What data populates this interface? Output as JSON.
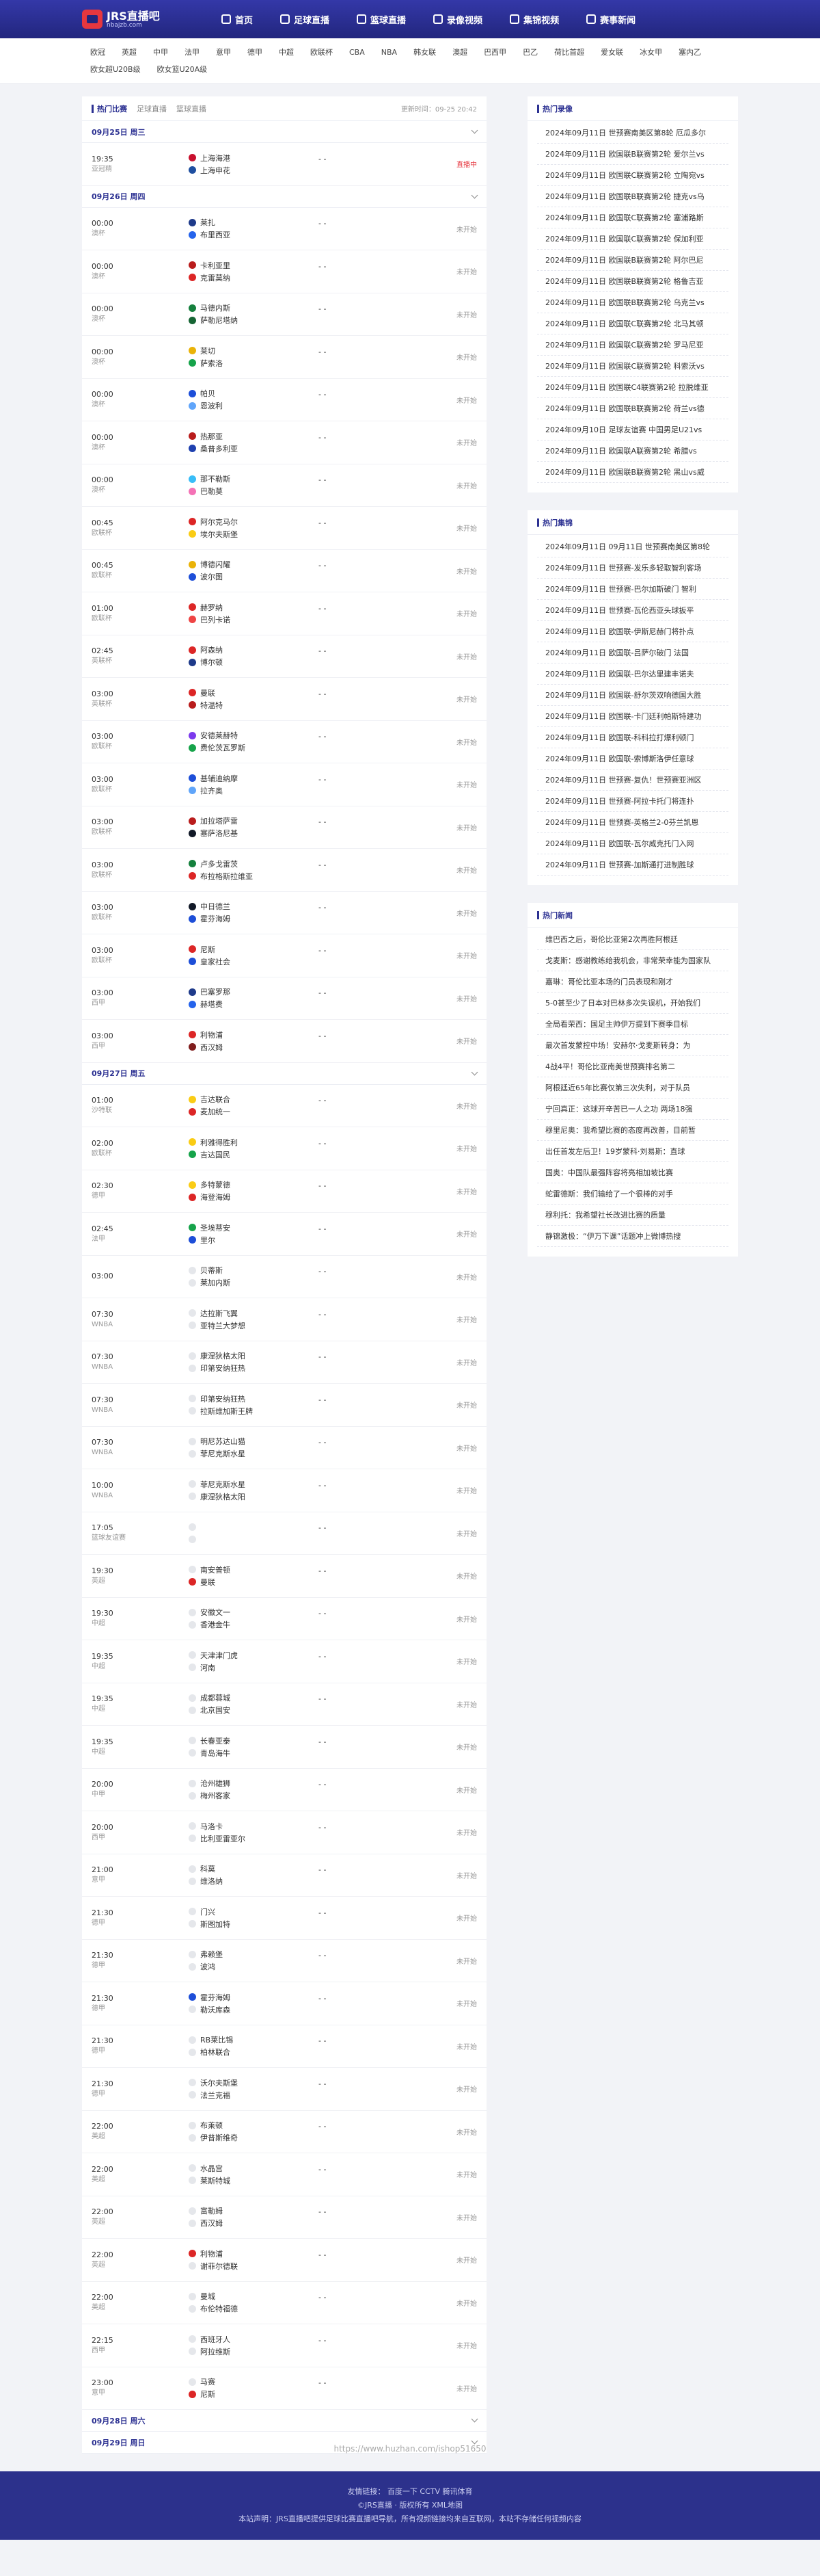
{
  "header": {
    "logo_title": "JRS直播吧",
    "logo_sub": "nbajzb.com",
    "nav": [
      "首页",
      "足球直播",
      "篮球直播",
      "录像视频",
      "集锦视频",
      "赛事新闻"
    ]
  },
  "leagues": [
    "欧冠",
    "英超",
    "中甲",
    "法甲",
    "意甲",
    "德甲",
    "中超",
    "欧联杯",
    "CBA",
    "NBA",
    "韩女联",
    "澳超",
    "巴西甲",
    "巴乙",
    "荷比首超",
    "爱女联",
    "冰女甲",
    "塞内乙",
    "欧女超U20B级",
    "欧女篮U20A级"
  ],
  "schedule": {
    "title": "热门比赛",
    "tabs": [
      "足球直播",
      "篮球直播"
    ],
    "update": "更新时间：09-25 20:42",
    "days": [
      {
        "date": "09月25日 周三",
        "matches": [
          {
            "time": "19:35",
            "league": "亚冠精",
            "home": "上海海港",
            "away": "上海申花",
            "status": "直播中",
            "live": true,
            "hc": "#c8102e",
            "ac": "#1f4fa0"
          }
        ]
      },
      {
        "date": "09月26日 周四",
        "matches": [
          {
            "time": "00:00",
            "league": "澳杯",
            "home": "莱扎",
            "away": "布里西亚",
            "status": "未开始",
            "hc": "#1e3a8a",
            "ac": "#2563eb"
          },
          {
            "time": "00:00",
            "league": "澳杯",
            "home": "卡利亚里",
            "away": "克雷莫纳",
            "status": "未开始",
            "hc": "#b91c1c",
            "ac": "#dc2626"
          },
          {
            "time": "00:00",
            "league": "澳杯",
            "home": "马德内斯",
            "away": "萨勒尼塔纳",
            "status": "未开始",
            "hc": "#15803d",
            "ac": "#166534"
          },
          {
            "time": "00:00",
            "league": "澳杯",
            "home": "莱切",
            "away": "萨索洛",
            "status": "未开始",
            "hc": "#eab308",
            "ac": "#16a34a"
          },
          {
            "time": "00:00",
            "league": "澳杯",
            "home": "帕贝",
            "away": "恩波利",
            "status": "未开始",
            "hc": "#1d4ed8",
            "ac": "#60a5fa"
          },
          {
            "time": "00:00",
            "league": "澳杯",
            "home": "热那亚",
            "away": "桑普多利亚",
            "status": "未开始",
            "hc": "#b91c1c",
            "ac": "#1e40af"
          },
          {
            "time": "00:00",
            "league": "澳杯",
            "home": "那不勒斯",
            "away": "巴勒莫",
            "status": "未开始",
            "hc": "#38bdf8",
            "ac": "#f472b6"
          },
          {
            "time": "00:45",
            "league": "欧联杯",
            "home": "阿尔克马尔",
            "away": "埃尔夫斯堡",
            "status": "未开始",
            "hc": "#dc2626",
            "ac": "#facc15"
          },
          {
            "time": "00:45",
            "league": "欧联杯",
            "home": "博德闪耀",
            "away": "波尔图",
            "status": "未开始",
            "hc": "#eab308",
            "ac": "#1d4ed8"
          },
          {
            "time": "01:00",
            "league": "欧联杯",
            "home": "赫罗纳",
            "away": "巴列卡诺",
            "status": "未开始",
            "hc": "#dc2626",
            "ac": "#ef4444"
          },
          {
            "time": "02:45",
            "league": "英联杯",
            "home": "阿森纳",
            "away": "博尔顿",
            "status": "未开始",
            "hc": "#dc2626",
            "ac": "#1e3a8a"
          },
          {
            "time": "03:00",
            "league": "英联杯",
            "home": "曼联",
            "away": "特温特",
            "status": "未开始",
            "hc": "#dc2626",
            "ac": "#b91c1c"
          },
          {
            "time": "03:00",
            "league": "欧联杯",
            "home": "安德莱赫特",
            "away": "费伦茨瓦罗斯",
            "status": "未开始",
            "hc": "#7c3aed",
            "ac": "#16a34a"
          },
          {
            "time": "03:00",
            "league": "欧联杯",
            "home": "基辅迪纳摩",
            "away": "拉齐奥",
            "status": "未开始",
            "hc": "#1d4ed8",
            "ac": "#60a5fa"
          },
          {
            "time": "03:00",
            "league": "欧联杯",
            "home": "加拉塔萨雷",
            "away": "塞萨洛尼基",
            "status": "未开始",
            "hc": "#b91c1c",
            "ac": "#111827"
          },
          {
            "time": "03:00",
            "league": "欧联杯",
            "home": "卢多戈雷茨",
            "away": "布拉格斯拉维亚",
            "status": "未开始",
            "hc": "#15803d",
            "ac": "#dc2626"
          },
          {
            "time": "03:00",
            "league": "欧联杯",
            "home": "中日德兰",
            "away": "霍芬海姆",
            "status": "未开始",
            "hc": "#111827",
            "ac": "#1d4ed8"
          },
          {
            "time": "03:00",
            "league": "欧联杯",
            "home": "尼斯",
            "away": "皇家社会",
            "status": "未开始",
            "hc": "#dc2626",
            "ac": "#1d4ed8"
          },
          {
            "time": "03:00",
            "league": "西甲",
            "home": "巴塞罗那",
            "away": "赫塔费",
            "status": "未开始",
            "hc": "#1e3a8a",
            "ac": "#2563eb"
          },
          {
            "time": "03:00",
            "league": "西甲",
            "home": "利物浦",
            "away": "西汉姆",
            "status": "未开始",
            "hc": "#dc2626",
            "ac": "#7f1d1d"
          }
        ]
      },
      {
        "date": "09月27日 周五",
        "matches": [
          {
            "time": "01:00",
            "league": "沙特联",
            "home": "吉达联合",
            "away": "麦加统一",
            "status": "未开始",
            "hc": "#facc15",
            "ac": "#dc2626"
          },
          {
            "time": "02:00",
            "league": "欧联杯",
            "home": "利雅得胜利",
            "away": "吉达国民",
            "status": "未开始",
            "hc": "#facc15",
            "ac": "#16a34a"
          },
          {
            "time": "02:30",
            "league": "德甲",
            "home": "多特蒙德",
            "away": "海登海姆",
            "status": "未开始",
            "hc": "#facc15",
            "ac": "#dc2626"
          },
          {
            "time": "02:45",
            "league": "法甲",
            "home": "圣埃蒂安",
            "away": "里尔",
            "status": "未开始",
            "hc": "#16a34a",
            "ac": "#1d4ed8"
          },
          {
            "time": "03:00",
            "league": "",
            "home": "贝蒂斯",
            "away": "莱加内斯",
            "status": "未开始",
            "hc": "#e5e7eb",
            "ac": "#e5e7eb"
          },
          {
            "time": "07:30",
            "league": "WNBA",
            "home": "达拉斯飞翼",
            "away": "亚特兰大梦想",
            "status": "未开始",
            "hc": "#e5e7eb",
            "ac": "#e5e7eb"
          },
          {
            "time": "07:30",
            "league": "WNBA",
            "home": "康涅狄格太阳",
            "away": "印第安纳狂热",
            "status": "未开始",
            "hc": "#e5e7eb",
            "ac": "#e5e7eb"
          },
          {
            "time": "07:30",
            "league": "WNBA",
            "home": "印第安纳狂热",
            "away": "拉斯维加斯王牌",
            "status": "未开始",
            "hc": "#e5e7eb",
            "ac": "#e5e7eb"
          },
          {
            "time": "07:30",
            "league": "WNBA",
            "home": "明尼苏达山猫",
            "away": "菲尼克斯水星",
            "status": "未开始",
            "hc": "#e5e7eb",
            "ac": "#e5e7eb"
          },
          {
            "time": "10:00",
            "league": "WNBA",
            "home": "菲尼克斯水星",
            "away": "康涅狄格太阳",
            "status": "未开始",
            "hc": "#e5e7eb",
            "ac": "#e5e7eb"
          },
          {
            "time": "17:05",
            "league": "篮球友谊赛",
            "home": "",
            "away": "",
            "status": "未开始",
            "hc": "#e5e7eb",
            "ac": "#e5e7eb"
          },
          {
            "time": "19:30",
            "league": "英超",
            "home": "南安普顿",
            "away": "曼联",
            "status": "未开始",
            "hc": "#e5e7eb",
            "ac": "#dc2626"
          },
          {
            "time": "19:30",
            "league": "中超",
            "home": "安徽文一",
            "away": "香港金牛",
            "status": "未开始",
            "hc": "#e5e7eb",
            "ac": "#e5e7eb"
          },
          {
            "time": "19:35",
            "league": "中超",
            "home": "天津津门虎",
            "away": "河南",
            "status": "未开始",
            "hc": "#e5e7eb",
            "ac": "#e5e7eb"
          },
          {
            "time": "19:35",
            "league": "中超",
            "home": "成都蓉城",
            "away": "北京国安",
            "status": "未开始",
            "hc": "#e5e7eb",
            "ac": "#e5e7eb"
          },
          {
            "time": "19:35",
            "league": "中超",
            "home": "长春亚泰",
            "away": "青岛海牛",
            "status": "未开始",
            "hc": "#e5e7eb",
            "ac": "#e5e7eb"
          },
          {
            "time": "20:00",
            "league": "中甲",
            "home": "沧州雄狮",
            "away": "梅州客家",
            "status": "未开始",
            "hc": "#e5e7eb",
            "ac": "#e5e7eb"
          },
          {
            "time": "20:00",
            "league": "西甲",
            "home": "马洛卡",
            "away": "比利亚雷亚尔",
            "status": "未开始",
            "hc": "#e5e7eb",
            "ac": "#e5e7eb"
          },
          {
            "time": "21:00",
            "league": "意甲",
            "home": "科莫",
            "away": "维洛纳",
            "status": "未开始",
            "hc": "#e5e7eb",
            "ac": "#e5e7eb"
          },
          {
            "time": "21:30",
            "league": "德甲",
            "home": "门兴",
            "away": "斯图加特",
            "status": "未开始",
            "hc": "#e5e7eb",
            "ac": "#e5e7eb"
          },
          {
            "time": "21:30",
            "league": "德甲",
            "home": "弗赖堡",
            "away": "波鸿",
            "status": "未开始",
            "hc": "#e5e7eb",
            "ac": "#e5e7eb"
          },
          {
            "time": "21:30",
            "league": "德甲",
            "home": "霍芬海姆",
            "away": "勒沃库森",
            "status": "未开始",
            "hc": "#1d4ed8",
            "ac": "#e5e7eb"
          },
          {
            "time": "21:30",
            "league": "德甲",
            "home": "RB莱比锡",
            "away": "柏林联合",
            "status": "未开始",
            "hc": "#e5e7eb",
            "ac": "#e5e7eb"
          },
          {
            "time": "21:30",
            "league": "德甲",
            "home": "沃尔夫斯堡",
            "away": "法兰克福",
            "status": "未开始",
            "hc": "#e5e7eb",
            "ac": "#e5e7eb"
          },
          {
            "time": "22:00",
            "league": "英超",
            "home": "布莱顿",
            "away": "伊普斯维奇",
            "status": "未开始",
            "hc": "#e5e7eb",
            "ac": "#e5e7eb"
          },
          {
            "time": "22:00",
            "league": "英超",
            "home": "水晶宫",
            "away": "莱斯特城",
            "status": "未开始",
            "hc": "#e5e7eb",
            "ac": "#e5e7eb"
          },
          {
            "time": "22:00",
            "league": "英超",
            "home": "富勒姆",
            "away": "西汉姆",
            "status": "未开始",
            "hc": "#e5e7eb",
            "ac": "#e5e7eb"
          },
          {
            "time": "22:00",
            "league": "英超",
            "home": "利物浦",
            "away": "谢菲尔德联",
            "status": "未开始",
            "hc": "#dc2626",
            "ac": "#e5e7eb"
          },
          {
            "time": "22:00",
            "league": "英超",
            "home": "曼城",
            "away": "布伦特福德",
            "status": "未开始",
            "hc": "#e5e7eb",
            "ac": "#e5e7eb"
          },
          {
            "time": "22:15",
            "league": "西甲",
            "home": "西班牙人",
            "away": "阿拉维斯",
            "status": "未开始",
            "hc": "#e5e7eb",
            "ac": "#e5e7eb"
          },
          {
            "time": "23:00",
            "league": "意甲",
            "home": "马赛",
            "away": "尼斯",
            "status": "未开始",
            "hc": "#e5e7eb",
            "ac": "#dc2626"
          }
        ]
      },
      {
        "date": "09月28日 周六",
        "matches": []
      },
      {
        "date": "09月29日 周日",
        "matches": []
      }
    ]
  },
  "videos": {
    "title": "热门录像",
    "items": [
      "2024年09月11日 世预赛南美区第8轮 厄瓜多尔",
      "2024年09月11日 欧国联B联赛第2轮 爱尔兰vs",
      "2024年09月11日 欧国联C联赛第2轮 立陶宛vs",
      "2024年09月11日 欧国联B联赛第2轮 捷克vs乌",
      "2024年09月11日 欧国联C联赛第2轮 塞浦路斯",
      "2024年09月11日 欧国联C联赛第2轮 保加利亚",
      "2024年09月11日 欧国联B联赛第2轮 阿尔巴尼",
      "2024年09月11日 欧国联B联赛第2轮 格鲁吉亚",
      "2024年09月11日 欧国联B联赛第2轮 乌克兰vs",
      "2024年09月11日 欧国联C联赛第2轮 北马其顿",
      "2024年09月11日 欧国联C联赛第2轮 罗马尼亚",
      "2024年09月11日 欧国联C联赛第2轮 科索沃vs",
      "2024年09月11日 欧国联C4联赛第2轮 拉脱维亚",
      "2024年09月11日 欧国联B联赛第2轮 荷兰vs德",
      "2024年09月10日 足球友谊赛 中国男足U21vs",
      "2024年09月11日 欧国联A联赛第2轮 希腊vs",
      "2024年09月11日 欧国联B联赛第2轮 黑山vs威"
    ]
  },
  "highlights": {
    "title": "热门集锦",
    "items": [
      "2024年09月11日 09月11日 世预赛南美区第8轮",
      "2024年09月11日 世预赛-发乐多轻取智利客场",
      "2024年09月11日 世预赛-巴尔加斯破门 智利",
      "2024年09月11日 世预赛-瓦伦西亚头球扳平",
      "2024年09月11日 欧国联-伊斯尼赫门将扑点",
      "2024年09月11日 欧国联-吕萨尔破门 法国",
      "2024年09月11日 欧国联-巴尔达里建丰诺夫",
      "2024年09月11日 欧国联-舒尔茨双响德国大胜",
      "2024年09月11日 欧国联-卡门廷利帕斯特建功",
      "2024年09月11日 欧国联-科科拉打爆利顿门",
      "2024年09月11日 欧国联-索博斯洛伊任意球",
      "2024年09月11日 世预赛-复仇！世预赛亚洲区",
      "2024年09月11日 世预赛-阿拉卡托门将连扑",
      "2024年09月11日 世预赛-英格兰2-0芬兰凯恩",
      "2024年09月11日 欧国联-瓦尔威克托门入网",
      "2024年09月11日 世预赛-加斯通打进制胜球"
    ]
  },
  "news": {
    "title": "热门新闻",
    "items": [
      "维巴西之后，哥伦比亚第2次再胜阿根廷",
      "戈麦斯：感谢教练给我机会，非常荣幸能为国家队",
      "嘉琳：哥伦比亚本场的门员表现和刚才",
      "5-0甚至少了日本对巴林多次失误机，开始我们",
      "全局看荣西：国足主帅伊万提到下赛季目标",
      "最次首发蒙控中场！安赫尔·戈麦斯转身：为",
      "4战4平！哥伦比亚南美世预赛排名第二",
      "阿根廷近65年比赛仅第三次失利，对于队员",
      "宁回真正：这球开辛苦已一人之功 两场18强",
      "穆里尼奥：我希望比赛的态度再改善，目前暂",
      "出任首发左后卫！19岁蒙科·刘易斯：直球",
      "国奥：中国队最强阵容将亮相加坡比赛",
      "蛇雷德斯：我们输给了一个很棒的对手",
      "穆利托：我希望社长改进比赛的质量",
      "静锦激极：“伊万下课”话题冲上微博热搜"
    ]
  },
  "watermark": "https://www.huzhan.com/ishop51650",
  "footer": {
    "line1": "友情链接：  百度一下  CCTV  腾讯体育",
    "line2": "©JRS直播 · 版权所有  XML地图",
    "line3": "本站声明：JRS直播吧提供足球比赛直播吧导航，所有视频链接均来自互联网，本站不存储任何视频内容"
  }
}
